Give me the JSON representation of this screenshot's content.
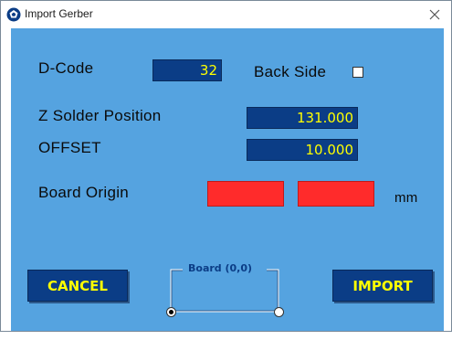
{
  "window": {
    "title": "Import Gerber",
    "close_glyph": "✕",
    "app_icon": "gerber-app-icon"
  },
  "form": {
    "dcode_label": "D-Code",
    "dcode_value": "32",
    "backside_label": "Back Side",
    "backside_checked": false,
    "zsolder_label": "Z Solder Position",
    "zsolder_value": "131.000",
    "offset_label": "OFFSET",
    "offset_value": "10.000",
    "origin_label": "Board Origin",
    "origin_x": "",
    "origin_y": "",
    "origin_unit": "mm"
  },
  "board_group": {
    "label": "Board (0,0)",
    "left_selected": true,
    "right_selected": false
  },
  "buttons": {
    "cancel": "CANCEL",
    "import": "IMPORT"
  },
  "colors": {
    "client_bg": "#55a3e0",
    "field_bg": "#0b3d86",
    "field_text": "#ffff00",
    "origin_field": "#ff2b2b"
  }
}
